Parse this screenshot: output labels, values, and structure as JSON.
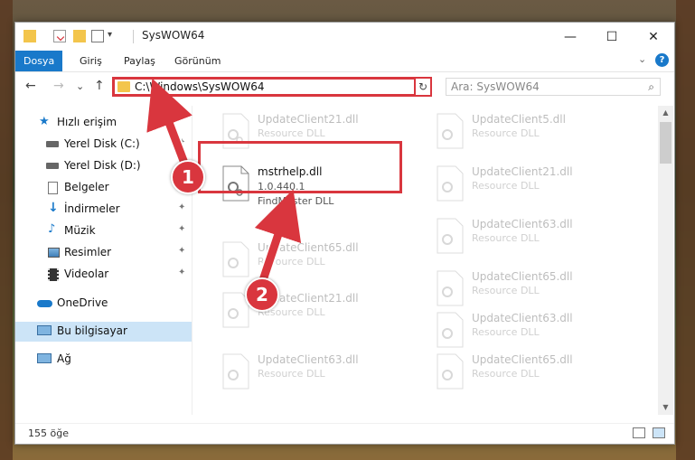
{
  "window": {
    "title": "SysWOW64"
  },
  "window_controls": {
    "minimize": "—",
    "maximize": "☐",
    "close": "✕"
  },
  "ribbon": {
    "tabs": [
      "Dosya",
      "Giriş",
      "Paylaş",
      "Görünüm"
    ],
    "active_tab": "Dosya",
    "help": "?",
    "collapse": "⌄"
  },
  "nav": {
    "back": "←",
    "forward": "→",
    "recent": "⌄",
    "up": "↑"
  },
  "address": {
    "path": "C:\\Windows\\SysWOW64",
    "dropdown": "⌄",
    "refresh": "↻"
  },
  "search": {
    "placeholder": "Ara: SysWOW64",
    "icon": "⌕"
  },
  "sidebar": {
    "items": [
      {
        "label": "Hızlı erişim",
        "icon": "star-icon",
        "pinned": false
      },
      {
        "label": "Yerel Disk (C:)",
        "icon": "drive-icon",
        "pinned": true
      },
      {
        "label": "Yerel Disk (D:)",
        "icon": "drive-icon",
        "pinned": true
      },
      {
        "label": "Belgeler",
        "icon": "document-icon",
        "pinned": true
      },
      {
        "label": "İndirmeler",
        "icon": "download-icon",
        "pinned": true
      },
      {
        "label": "Müzik",
        "icon": "music-icon",
        "pinned": true
      },
      {
        "label": "Resimler",
        "icon": "pictures-icon",
        "pinned": true
      },
      {
        "label": "Videolar",
        "icon": "video-icon",
        "pinned": true
      },
      {
        "label": "OneDrive",
        "icon": "cloud-icon",
        "pinned": false
      },
      {
        "label": "Bu bilgisayar",
        "icon": "computer-icon",
        "pinned": false,
        "selected": true
      },
      {
        "label": "Ağ",
        "icon": "network-icon",
        "pinned": false
      }
    ],
    "pin_glyph": "📌"
  },
  "files": {
    "highlighted": {
      "name": "mstrhelp.dll",
      "version": "1.0.440.1",
      "description": "FindMaster DLL"
    },
    "faded_left": [
      {
        "name": "UpdateClient21.dll",
        "description": "Resource DLL"
      },
      {
        "name": "UpdateClient65.dll",
        "description": "Resource DLL"
      },
      {
        "name": "UpdateClient21.dll",
        "description": "Resource DLL"
      },
      {
        "name": "UpdateClient63.dll",
        "description": "Resource DLL"
      }
    ],
    "faded_right": [
      {
        "name": "UpdateClient5.dll",
        "description": "Resource DLL"
      },
      {
        "name": "UpdateClient21.dll",
        "description": "Resource DLL"
      },
      {
        "name": "UpdateClient63.dll",
        "description": "Resource DLL"
      },
      {
        "name": "UpdateClient65.dll",
        "description": "Resource DLL"
      },
      {
        "name": "UpdateClient63.dll",
        "description": "Resource DLL"
      },
      {
        "name": "UpdateClient65.dll",
        "description": "Resource DLL"
      }
    ]
  },
  "status": {
    "count": "155 öğe"
  },
  "callouts": [
    "1",
    "2"
  ],
  "colors": {
    "accent": "#1979ca",
    "highlight": "#d9363e",
    "selected": "#cce4f7"
  }
}
